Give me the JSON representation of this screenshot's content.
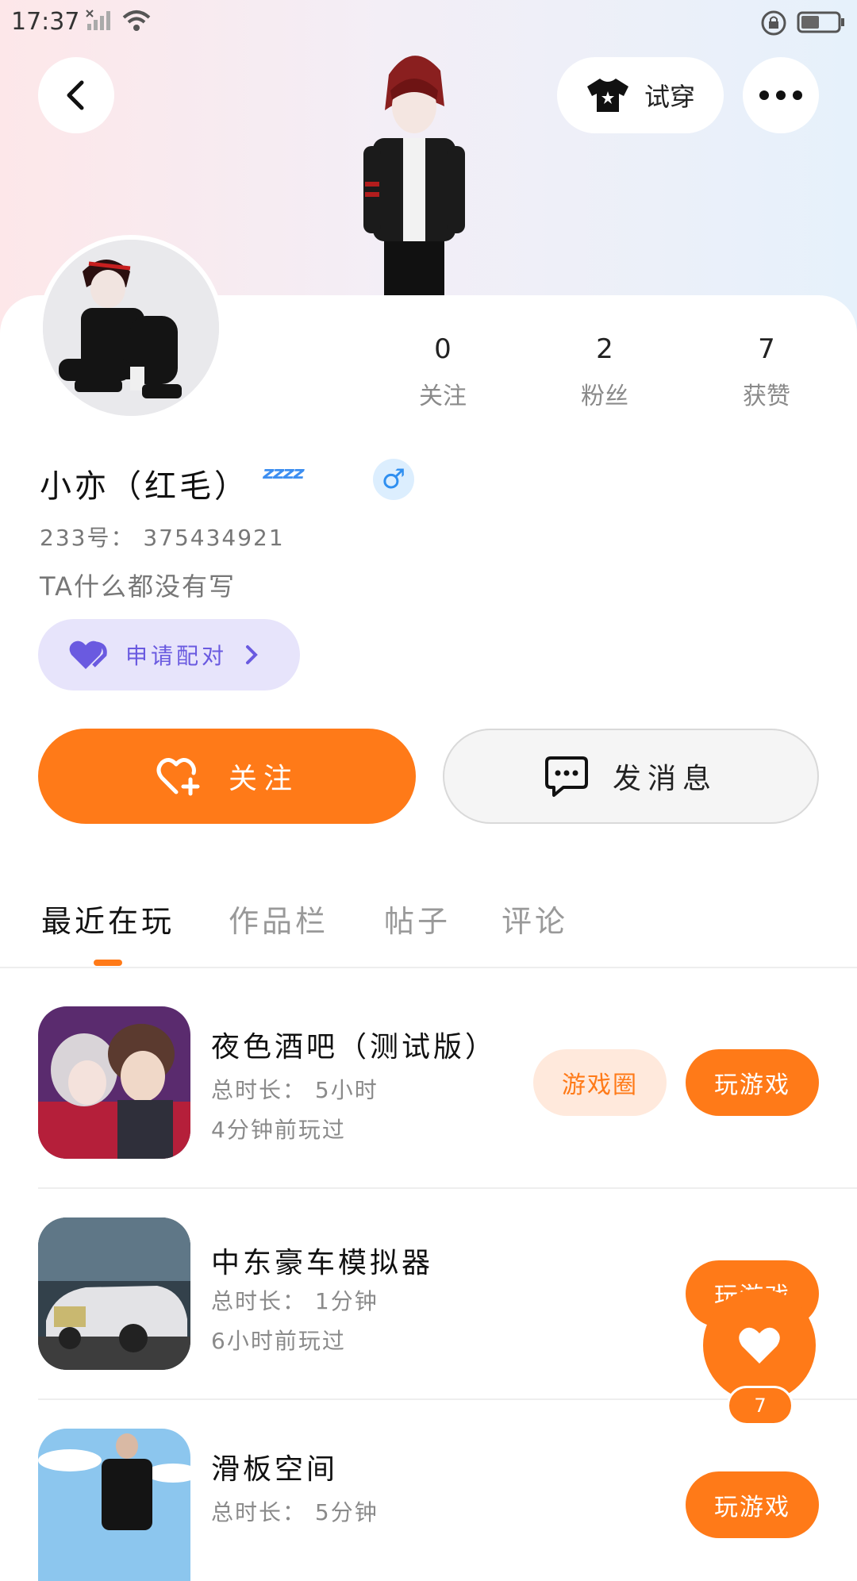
{
  "status_bar": {
    "time": "17:37"
  },
  "header": {
    "try_on_label": "试穿"
  },
  "profile": {
    "name": "小亦（红毛）",
    "zzz": "ᶻᶻᶻᶻ",
    "gender_symbol": "♂",
    "uid": "233号： 375434921",
    "bio": "TA什么都没有写",
    "pair_label": "申请配对",
    "stats": [
      {
        "value": "0",
        "label": "关注"
      },
      {
        "value": "2",
        "label": "粉丝"
      },
      {
        "value": "7",
        "label": "获赞"
      }
    ]
  },
  "actions": {
    "follow_label": "关注",
    "message_label": "发消息"
  },
  "tabs": [
    {
      "label": "最近在玩",
      "active": true
    },
    {
      "label": "作品栏",
      "active": false
    },
    {
      "label": "帖子",
      "active": false
    },
    {
      "label": "评论",
      "active": false
    }
  ],
  "games": [
    {
      "title": "夜色酒吧（测试版）",
      "duration": "总时长： 5小时",
      "last_played": "4分钟前玩过",
      "circle_label": "游戏圈",
      "play_label": "玩游戏"
    },
    {
      "title": "中东豪车模拟器",
      "duration": "总时长： 1分钟",
      "last_played": "6小时前玩过",
      "play_label": "玩游戏"
    },
    {
      "title": "滑板空间",
      "duration": "总时长： 5分钟",
      "play_label": "玩游戏"
    }
  ],
  "floating_like": {
    "count": "7"
  },
  "colors": {
    "accent": "#ff7a18",
    "pair_bg": "#e7e4fb",
    "pair_text": "#6a5ae0",
    "gender_blue": "#2f8ff0"
  }
}
